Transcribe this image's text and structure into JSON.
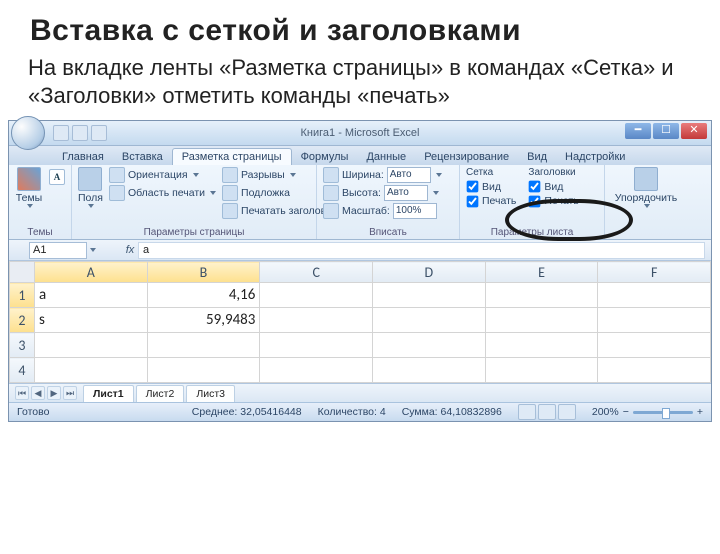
{
  "slide": {
    "heading": "Вставка с сеткой и заголовками",
    "paragraph": "На вкладке ленты «Разметка страницы» в командах «Сетка» и «Заголовки» отметить команды «печать»"
  },
  "window": {
    "title": "Книга1 - Microsoft Excel"
  },
  "tabs": {
    "items": [
      "Главная",
      "Вставка",
      "Разметка страницы",
      "Формулы",
      "Данные",
      "Рецензирование",
      "Вид",
      "Надстройки"
    ],
    "active_index": 2
  },
  "ribbon": {
    "themes": {
      "label": "Темы",
      "buttons": [
        "Темы"
      ]
    },
    "page_setup": {
      "label": "Параметры страницы",
      "margins": "Поля",
      "orientation": "Ориентация",
      "print_area": "Область печати",
      "breaks": "Разрывы",
      "background": "Подложка",
      "print_titles": "Печатать заголовки"
    },
    "scale": {
      "label": "Вписать",
      "width_label": "Ширина:",
      "width_value": "Авто",
      "height_label": "Высота:",
      "height_value": "Авто",
      "scale_label": "Масштаб:",
      "scale_value": "100%"
    },
    "sheet_options": {
      "label": "Параметры листа",
      "gridlines_header": "Сетка",
      "headings_header": "Заголовки",
      "view": "Вид",
      "print": "Печать"
    },
    "arrange": {
      "label": "Упорядочить",
      "button": "Упорядочить"
    }
  },
  "formula_bar": {
    "name_box": "A1",
    "fx": "fx",
    "content": "a"
  },
  "grid": {
    "columns": [
      "A",
      "B",
      "C",
      "D",
      "E",
      "F"
    ],
    "rows": [
      {
        "h": "1",
        "cells": [
          "a",
          "4,16",
          "",
          "",
          "",
          ""
        ]
      },
      {
        "h": "2",
        "cells": [
          "s",
          "59,9483",
          "",
          "",
          "",
          ""
        ]
      },
      {
        "h": "3",
        "cells": [
          "",
          "",
          "",
          "",
          "",
          ""
        ]
      },
      {
        "h": "4",
        "cells": [
          "",
          "",
          "",
          "",
          "",
          ""
        ]
      }
    ]
  },
  "sheet_tabs": {
    "items": [
      "Лист1",
      "Лист2",
      "Лист3"
    ],
    "active_index": 0
  },
  "status": {
    "ready": "Готово",
    "average_label": "Среднее:",
    "average_value": "32,05416448",
    "count_label": "Количество:",
    "count_value": "4",
    "sum_label": "Сумма:",
    "sum_value": "64,10832896",
    "zoom": "200%"
  }
}
